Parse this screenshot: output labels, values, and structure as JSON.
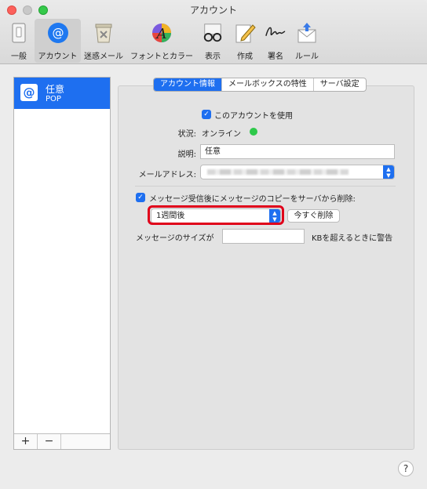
{
  "window": {
    "title": "アカウント"
  },
  "toolbar": {
    "items": [
      {
        "label": "一般",
        "icon": "switch-icon"
      },
      {
        "label": "アカウント",
        "icon": "at-sign-icon"
      },
      {
        "label": "迷惑メール",
        "icon": "trash-icon"
      },
      {
        "label": "フォントとカラー",
        "icon": "font-icon"
      },
      {
        "label": "表示",
        "icon": "glasses-icon"
      },
      {
        "label": "作成",
        "icon": "pencil-icon"
      },
      {
        "label": "署名",
        "icon": "signature-icon"
      },
      {
        "label": "ルール",
        "icon": "rules-icon"
      }
    ]
  },
  "sidebar": {
    "account": {
      "name": "任意",
      "type": "POP"
    },
    "add_label": "+",
    "remove_label": "−"
  },
  "tabs": [
    "アカウント情報",
    "メールボックスの特性",
    "サーバ設定"
  ],
  "form": {
    "enable_label": "このアカウントを使用",
    "status_label": "状況:",
    "status_value": "オンライン",
    "description_label": "説明:",
    "description_value": "任意",
    "email_label": "メールアドレス:",
    "delete_label": "メッセージ受信後にメッセージのコピーをサーバから削除:",
    "delete_period": "1週間後",
    "delete_now": "今すぐ削除",
    "size_label": "メッセージのサイズが",
    "size_suffix": "KBを超えるときに警告",
    "size_value": ""
  },
  "help_label": "?",
  "colors": {
    "accent": "#1e6ff0",
    "status_online": "#2ec94a",
    "highlight": "#e0001a"
  }
}
